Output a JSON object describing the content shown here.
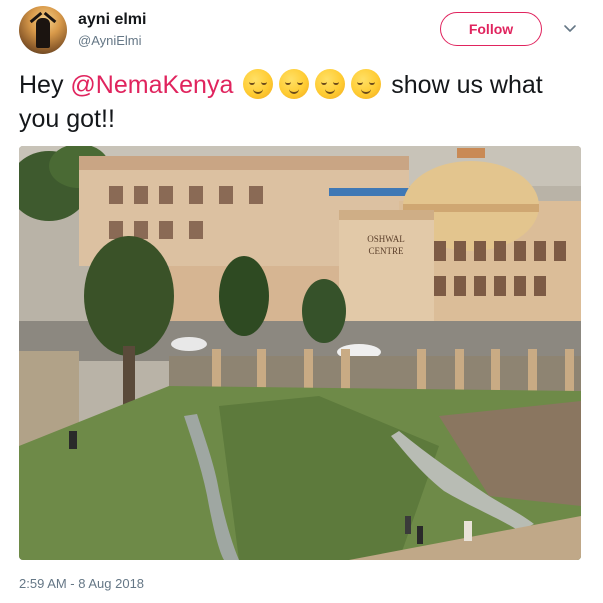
{
  "user": {
    "name": "ayni elmi",
    "handle": "@AyniElmi",
    "avatar_icon": "avatar-silhouette"
  },
  "actions": {
    "follow_label": "Follow",
    "more_icon": "chevron-down-icon"
  },
  "tweet": {
    "text_before": "Hey ",
    "mention": "@NemaKenya",
    "emoji": [
      "relieved-face",
      "relieved-face",
      "relieved-face",
      "relieved-face"
    ],
    "text_after": " show us what you got!!"
  },
  "media": {
    "sign_line1": "OSHWAL",
    "sign_line2": "CENTRE"
  },
  "meta": {
    "timestamp": "2:59 AM - 8 Aug 2018"
  },
  "colors": {
    "accent": "#e0245e",
    "secondary_text": "#657786",
    "primary_text": "#14171a"
  }
}
